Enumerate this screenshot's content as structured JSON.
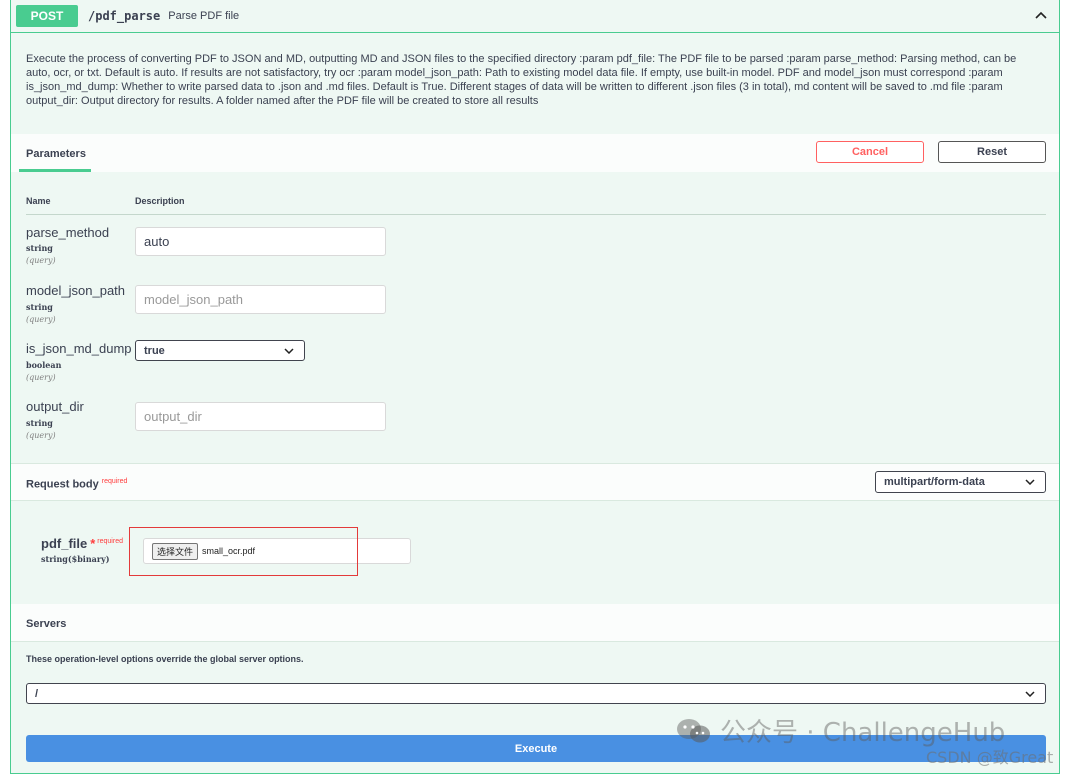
{
  "operation": {
    "method": "POST",
    "path": "/pdf_parse",
    "summary": "Parse PDF file",
    "description": "Execute the process of converting PDF to JSON and MD, outputting MD and JSON files to the specified directory :param pdf_file: The PDF file to be parsed :param parse_method: Parsing method, can be auto, ocr, or txt. Default is auto. If results are not satisfactory, try ocr :param model_json_path: Path to existing model data file. If empty, use built-in model. PDF and model_json must correspond :param is_json_md_dump: Whether to write parsed data to .json and .md files. Default is True. Different stages of data will be written to different .json files (3 in total), md content will be saved to .md file :param output_dir: Output directory for results. A folder named after the PDF file will be created to store all results"
  },
  "parameters": {
    "tab_label": "Parameters",
    "cancel_label": "Cancel",
    "reset_label": "Reset",
    "col_name": "Name",
    "col_description": "Description",
    "items": [
      {
        "name": "parse_method",
        "type": "string",
        "in": "(query)",
        "value": "auto",
        "placeholder": ""
      },
      {
        "name": "model_json_path",
        "type": "string",
        "in": "(query)",
        "value": "",
        "placeholder": "model_json_path"
      },
      {
        "name": "is_json_md_dump",
        "type": "boolean",
        "in": "(query)",
        "value": "true",
        "placeholder": ""
      },
      {
        "name": "output_dir",
        "type": "string",
        "in": "(query)",
        "value": "",
        "placeholder": "output_dir"
      }
    ]
  },
  "request_body": {
    "title": "Request body",
    "required_label": "required",
    "content_type": "multipart/form-data",
    "field_name": "pdf_file",
    "field_star": "*",
    "field_required": "required",
    "field_type": "string($binary)",
    "file_button": "选择文件",
    "file_name": "small_ocr.pdf"
  },
  "servers": {
    "title": "Servers",
    "note": "These operation-level options override the global server options.",
    "selected": "/"
  },
  "execute_label": "Execute",
  "watermark": {
    "line1": "公众号 · ChallengeHub",
    "line2": "CSDN @致Great"
  },
  "colors": {
    "post_green": "#49cc90",
    "cancel_red": "#ff6060",
    "execute_blue": "#4990e2"
  }
}
